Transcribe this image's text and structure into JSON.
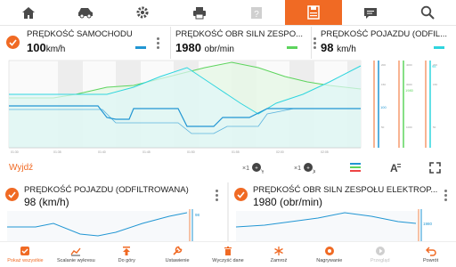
{
  "colors": {
    "accent": "#f06a24",
    "speed": "#2196d3",
    "rpm": "#5dd45d",
    "filtered": "#2fd5de"
  },
  "nav": [
    "home-icon",
    "car-icon",
    "gear-icon",
    "print-icon",
    "help-icon",
    "save-icon",
    "chat-icon",
    "search-icon"
  ],
  "params": [
    {
      "title": "PRĘDKOŚĆ SAMOCHODU",
      "value": "100",
      "unit": "km/h",
      "color": "#2196d3"
    },
    {
      "title": "PRĘDKOŚĆ OBR SILN ZESPO...",
      "value": "1980",
      "unit": "obr/min",
      "color": "#5dd45d"
    },
    {
      "title": "PRĘDKOŚĆ POJAZDU (ODFIL...",
      "value": "98",
      "unit": "km/h",
      "color": "#2fd5de"
    }
  ],
  "toolbar": {
    "exit_label": "Wyjdź",
    "zoom_y": "×1",
    "zoom_x": "×1"
  },
  "cards": [
    {
      "title": "PRĘDKOŚĆ POJAZDU (ODFILTROWANA)",
      "value": "98 (km/h)",
      "marker": "98"
    },
    {
      "title": "PRĘDKOŚĆ OBR SILN ZESPOŁU ELEKTROP...",
      "value": "1980 (obr/min)",
      "marker": "1980"
    }
  ],
  "main_axis_labels": {
    "speed_marker": "100",
    "rpm_marker": "1980",
    "filtered_marker": "98"
  },
  "bottom": [
    {
      "label": "Pokaż wszystkie",
      "icon": "show-all-icon"
    },
    {
      "label": "Scalanie wykresu",
      "icon": "merge-chart-icon"
    },
    {
      "label": "Do góry",
      "icon": "up-arrow-icon"
    },
    {
      "label": "Ustawienie",
      "icon": "wrench-icon"
    },
    {
      "label": "Wyczyść dane",
      "icon": "trash-icon"
    },
    {
      "label": "Zamroź",
      "icon": "snowflake-icon"
    },
    {
      "label": "Nagrywanie",
      "icon": "record-icon"
    },
    {
      "label": "Przegląd",
      "icon": "play-icon"
    },
    {
      "label": "Powrót",
      "icon": "back-icon"
    }
  ]
}
